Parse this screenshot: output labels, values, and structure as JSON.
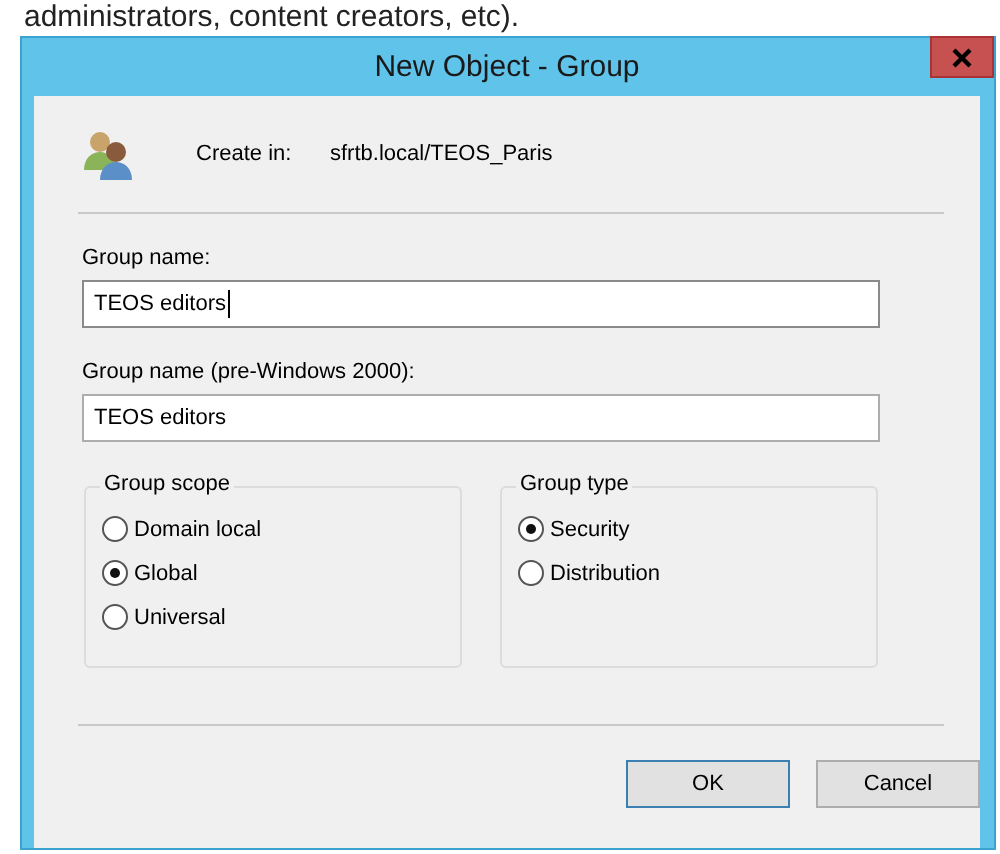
{
  "caption_fragment": "administrators, content creators, etc).",
  "window": {
    "title": "New Object - Group"
  },
  "create_in": {
    "label": "Create in:",
    "path": "sfrtb.local/TEOS_Paris"
  },
  "fields": [
    {
      "label": "Group name:",
      "value": "TEOS editors",
      "focused": true
    },
    {
      "label": "Group name (pre-Windows 2000):",
      "value": "TEOS editors",
      "focused": false
    }
  ],
  "groups": [
    {
      "title": "Group scope",
      "options": [
        {
          "label": "Domain local",
          "selected": false
        },
        {
          "label": "Global",
          "selected": true
        },
        {
          "label": "Universal",
          "selected": false
        }
      ]
    },
    {
      "title": "Group type",
      "options": [
        {
          "label": "Security",
          "selected": true
        },
        {
          "label": "Distribution",
          "selected": false
        }
      ]
    }
  ],
  "buttons": [
    {
      "label": "OK",
      "default": true
    },
    {
      "label": "Cancel",
      "default": false
    }
  ]
}
